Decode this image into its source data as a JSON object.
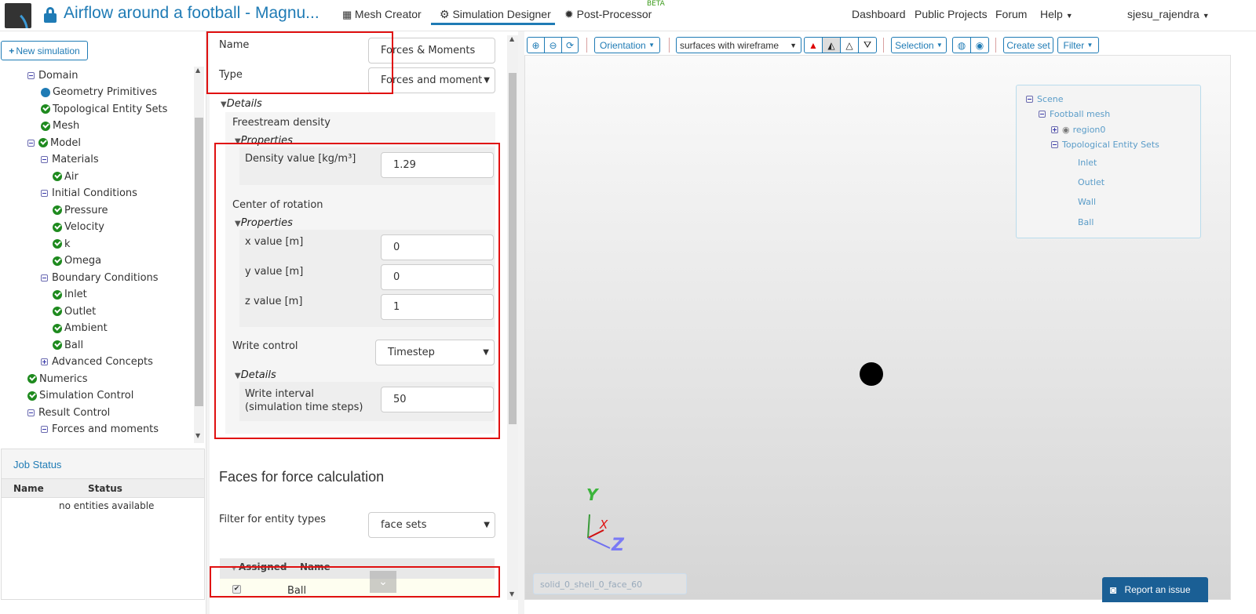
{
  "header": {
    "title": "Airflow around a football - Magnu...",
    "nav": [
      "Mesh Creator",
      "Simulation Designer",
      "Post-Processor"
    ],
    "beta": "BETA",
    "links": [
      "Dashboard",
      "Public Projects",
      "Forum",
      "Help"
    ],
    "user": "sjesu_rajendra"
  },
  "left": {
    "new_simulation": "New simulation",
    "tree": [
      {
        "label": "Domain",
        "icon": "minus",
        "level": 0
      },
      {
        "label": "Geometry Primitives",
        "icon": "dot",
        "level": 1
      },
      {
        "label": "Topological Entity Sets",
        "icon": "check",
        "level": 1
      },
      {
        "label": "Mesh",
        "icon": "check",
        "level": 1
      },
      {
        "label": "Model",
        "icon": "minus-check",
        "level": 0
      },
      {
        "label": "Materials",
        "icon": "minus",
        "level": 1
      },
      {
        "label": "Air",
        "icon": "check",
        "level": 2
      },
      {
        "label": "Initial Conditions",
        "icon": "minus",
        "level": 1
      },
      {
        "label": "Pressure",
        "icon": "check",
        "level": 2
      },
      {
        "label": "Velocity",
        "icon": "check",
        "level": 2
      },
      {
        "label": "k",
        "icon": "check",
        "level": 2
      },
      {
        "label": "Omega",
        "icon": "check",
        "level": 2
      },
      {
        "label": "Boundary Conditions",
        "icon": "minus",
        "level": 1
      },
      {
        "label": "Inlet",
        "icon": "check",
        "level": 2
      },
      {
        "label": "Outlet",
        "icon": "check",
        "level": 2
      },
      {
        "label": "Ambient",
        "icon": "check",
        "level": 2
      },
      {
        "label": "Ball",
        "icon": "check",
        "level": 2
      },
      {
        "label": "Advanced Concepts",
        "icon": "plus",
        "level": 1
      },
      {
        "label": "Numerics",
        "icon": "check",
        "level": 0
      },
      {
        "label": "Simulation Control",
        "icon": "check",
        "level": 0
      },
      {
        "label": "Result Control",
        "icon": "minus",
        "level": 0
      },
      {
        "label": "Forces and moments",
        "icon": "minus",
        "level": 1
      }
    ],
    "job_status": {
      "title": "Job Status",
      "col_name": "Name",
      "col_status": "Status",
      "empty": "no entities available"
    }
  },
  "form": {
    "name_label": "Name",
    "name_value": "Forces & Moments",
    "type_label": "Type",
    "type_value": "Forces and moment",
    "details": "Details",
    "freestream": "Freestream density",
    "properties": "Properties",
    "density_label": "Density value [kg/m³]",
    "density_value": "1.29",
    "center": "Center of rotation",
    "x_label": "x value [m]",
    "x_value": "0",
    "y_label": "y value [m]",
    "y_value": "0",
    "z_label": "z value [m]",
    "z_value": "1",
    "write_control_label": "Write control",
    "write_control_value": "Timestep",
    "write_interval_label": "Write interval (simulation time steps)",
    "write_interval_value": "50",
    "faces_heading": "Faces for force calculation",
    "filter_label": "Filter for entity types",
    "filter_value": "face sets",
    "col_assigned": "Assigned",
    "col_name": "Name",
    "rows": [
      {
        "assigned": true,
        "name": "Ball"
      }
    ]
  },
  "viewer": {
    "orientation": "Orientation",
    "render_mode": "surfaces with wireframe",
    "selection": "Selection",
    "create_set": "Create set",
    "filter": "Filter",
    "scene": {
      "root": "Scene",
      "mesh": "Football mesh",
      "region": "region0",
      "sets_label": "Topological Entity Sets",
      "sets": [
        "Inlet",
        "Outlet",
        "Wall",
        "Ball"
      ]
    },
    "axes": {
      "x": "X",
      "y": "Y",
      "z": "Z"
    },
    "hover_face": "solid_0_shell_0_face_60",
    "report": "Report an issue"
  }
}
